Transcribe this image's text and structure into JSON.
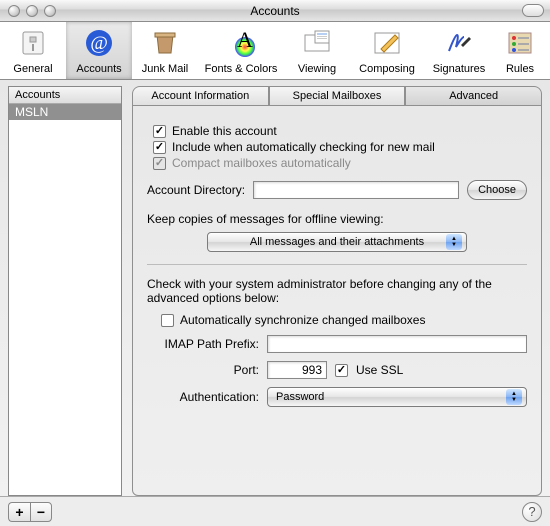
{
  "window": {
    "title": "Accounts"
  },
  "toolbar": {
    "items": [
      {
        "label": "General"
      },
      {
        "label": "Accounts"
      },
      {
        "label": "Junk Mail"
      },
      {
        "label": "Fonts & Colors"
      },
      {
        "label": "Viewing"
      },
      {
        "label": "Composing"
      },
      {
        "label": "Signatures"
      },
      {
        "label": "Rules"
      }
    ],
    "selected_index": 1
  },
  "sidebar": {
    "header": "Accounts",
    "items": [
      {
        "name": "MSLN"
      }
    ],
    "selected_index": 0
  },
  "tabs": {
    "items": [
      "Account Information",
      "Special Mailboxes",
      "Advanced"
    ],
    "selected_index": 2
  },
  "advanced": {
    "enable_account": {
      "label": "Enable this account",
      "checked": true
    },
    "include_auto_check": {
      "label": "Include when automatically checking for new mail",
      "checked": true
    },
    "compact_mailboxes": {
      "label": "Compact mailboxes automatically",
      "checked": true,
      "disabled": true
    },
    "account_directory": {
      "label": "Account Directory:",
      "value": "",
      "choose": "Choose"
    },
    "keep_copies": {
      "label": "Keep copies of messages for offline viewing:",
      "selected": "All messages and their attachments"
    },
    "admin_note": "Check with your system administrator before changing any of the advanced options below:",
    "auto_sync": {
      "label": "Automatically synchronize changed mailboxes",
      "checked": false
    },
    "imap_prefix": {
      "label": "IMAP Path Prefix:",
      "value": ""
    },
    "port": {
      "label": "Port:",
      "value": "993"
    },
    "use_ssl": {
      "label": "Use SSL",
      "checked": true
    },
    "authentication": {
      "label": "Authentication:",
      "selected": "Password"
    }
  },
  "bottom": {
    "add": "+",
    "remove": "−",
    "help": "?"
  }
}
